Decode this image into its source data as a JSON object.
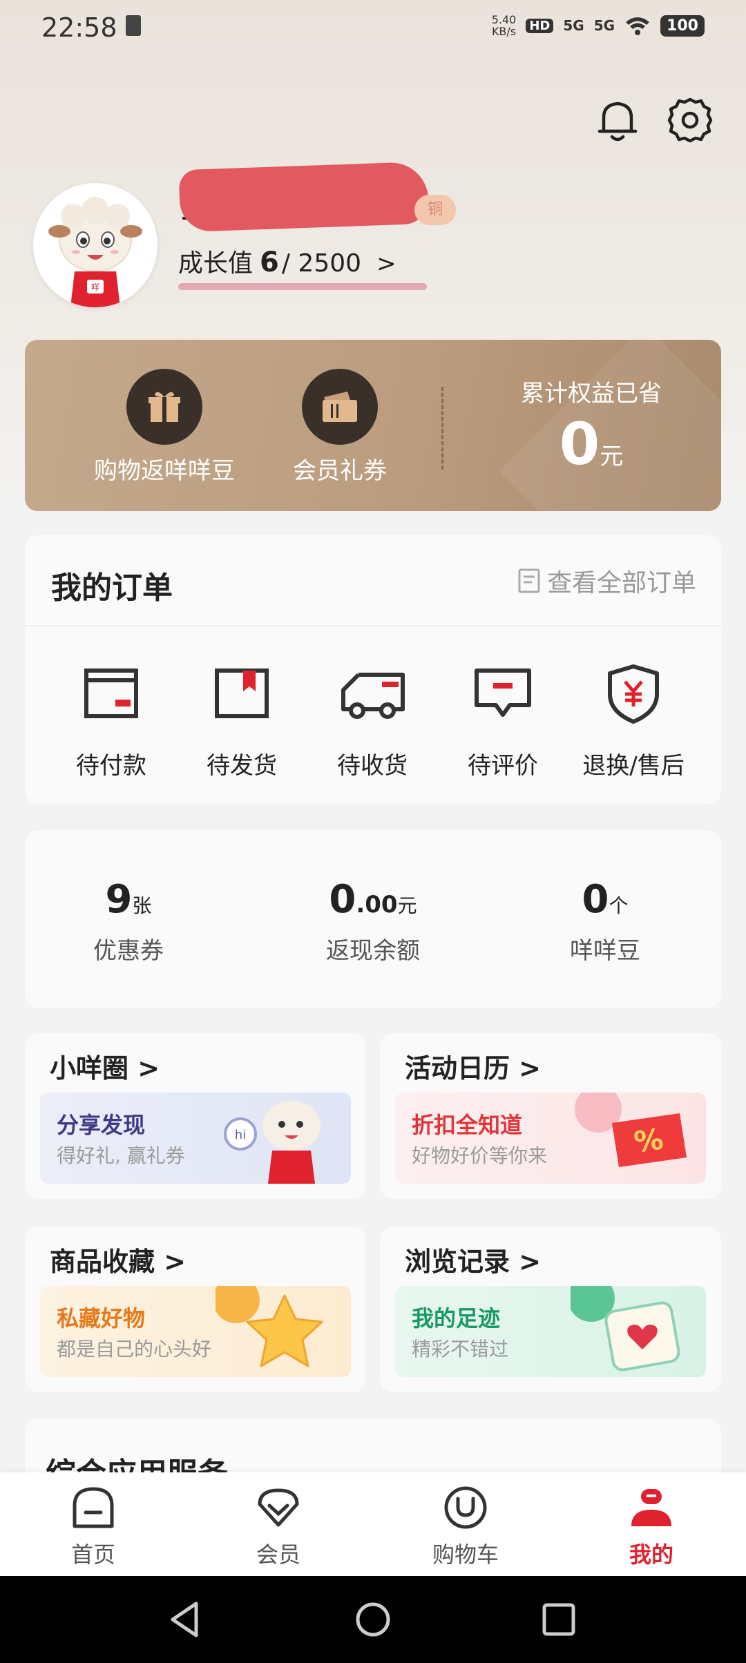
{
  "status_bar": {
    "time": "22:58",
    "net_speed_top": "5.40",
    "net_speed_bottom": "KB/s",
    "hd": "HD",
    "signal_1": "5G",
    "signal_2": "5G",
    "battery": "100"
  },
  "profile": {
    "name_visible": "13",
    "level_tag": "铜",
    "growth_label": "成长值",
    "growth_value": "6",
    "growth_total": "/ 2500",
    "growth_arrow": ">",
    "growth_progress": 0.0024
  },
  "benefits": {
    "items": [
      {
        "label": "购物返咩咩豆",
        "icon": "gift-icon"
      },
      {
        "label": "会员礼券",
        "icon": "ticket-icon"
      }
    ],
    "saved_title": "累计权益已省",
    "saved_value": "0",
    "saved_unit": "元"
  },
  "orders": {
    "title": "我的订单",
    "view_all": "查看全部订单",
    "items": [
      {
        "label": "待付款",
        "icon": "wallet-icon"
      },
      {
        "label": "待发货",
        "icon": "box-icon"
      },
      {
        "label": "待收货",
        "icon": "truck-icon"
      },
      {
        "label": "待评价",
        "icon": "comment-icon"
      },
      {
        "label": "退换/售后",
        "icon": "shield-yen-icon"
      }
    ]
  },
  "assets": [
    {
      "value": "9",
      "unit": "张",
      "label": "优惠券"
    },
    {
      "value": "0",
      "decimal": ".00",
      "unit": "元",
      "label": "返现余额"
    },
    {
      "value": "0",
      "unit": "个",
      "label": "咩咩豆"
    }
  ],
  "tiles": [
    {
      "title": "小咩圈 >",
      "headline": "分享发现",
      "sub": "得好礼, 赢礼券",
      "head_color": "#3f3a86"
    },
    {
      "title": "活动日历 >",
      "headline": "折扣全知道",
      "sub": "好物好价等你来",
      "head_color": "#e0353b"
    },
    {
      "title": "商品收藏 >",
      "headline": "私藏好物",
      "sub": "都是自己的心头好",
      "head_color": "#e8791a"
    },
    {
      "title": "浏览记录 >",
      "headline": "我的足迹",
      "sub": "精彩不错过",
      "head_color": "#1a9a63"
    }
  ],
  "services": {
    "title": "综合应用服务"
  },
  "tab_bar": {
    "tabs": [
      {
        "label": "首页"
      },
      {
        "label": "会员"
      },
      {
        "label": "购物车"
      },
      {
        "label": "我的"
      }
    ],
    "active": "我的"
  },
  "colors": {
    "accent": "#e0222e",
    "gold_card": "#bb9c7f",
    "icon_dark": "#333333",
    "icon_red": "#e0222e"
  }
}
